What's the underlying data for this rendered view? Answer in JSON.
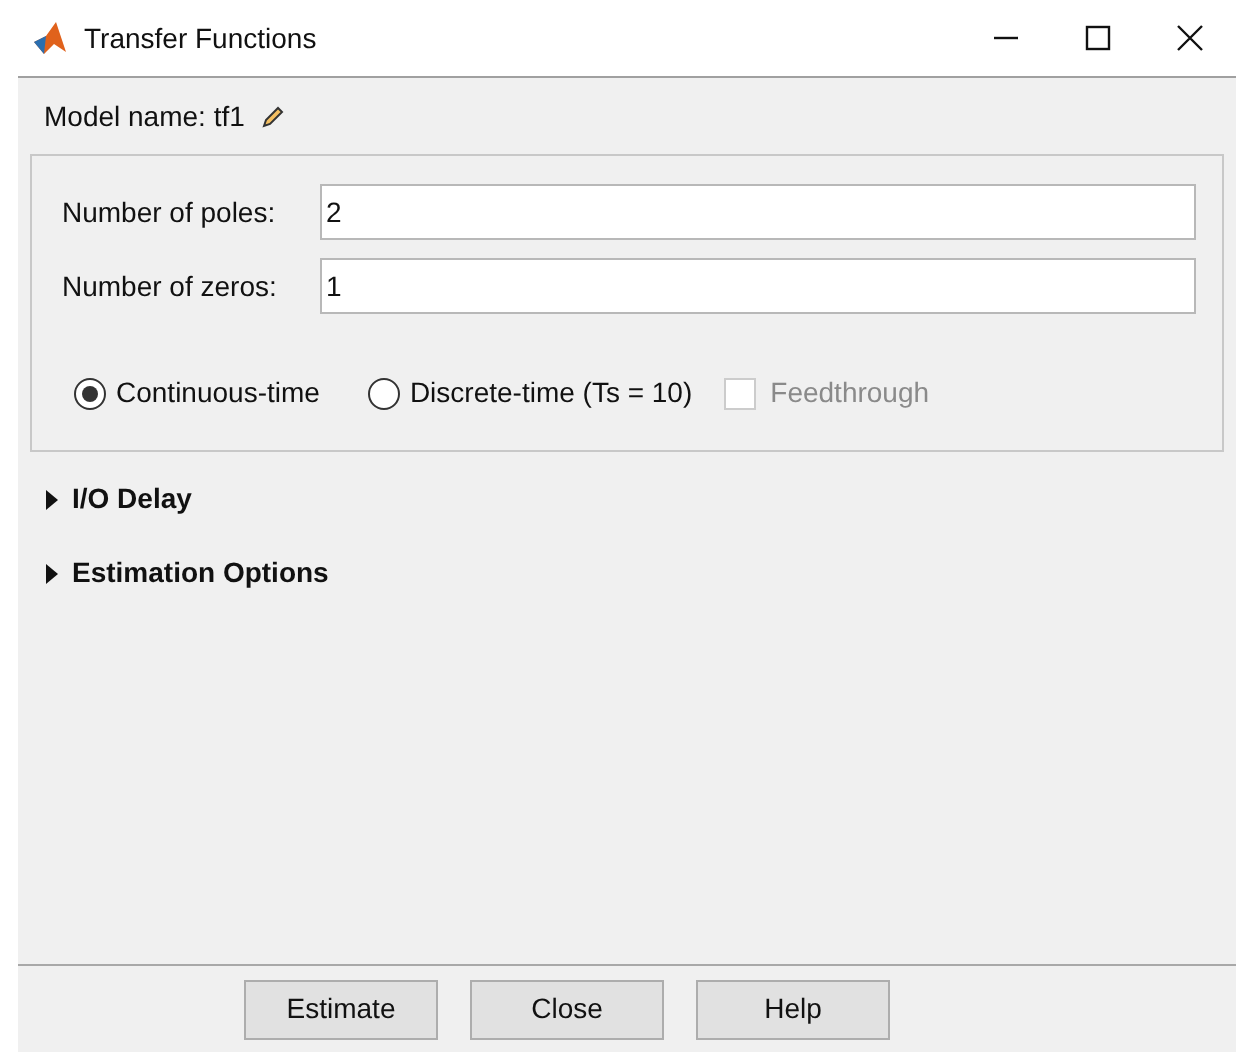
{
  "window": {
    "title": "Transfer Functions"
  },
  "model_name": {
    "label": "Model name: tf1"
  },
  "fields": [
    {
      "label": "Number of poles:",
      "value": "2"
    },
    {
      "label": "Number of zeros:",
      "value": "1"
    }
  ],
  "time_options": [
    {
      "kind": "radio",
      "label": "Continuous-time",
      "selected": true,
      "disabled": false
    },
    {
      "kind": "radio",
      "label": "Discrete-time (Ts = 10)",
      "selected": false,
      "disabled": false
    },
    {
      "kind": "checkbox",
      "label": "Feedthrough",
      "checked": false,
      "disabled": true
    }
  ],
  "sections": [
    {
      "label": "I/O Delay",
      "expanded": false
    },
    {
      "label": "Estimation Options",
      "expanded": false
    }
  ],
  "buttons": [
    "Estimate",
    "Close",
    "Help"
  ]
}
